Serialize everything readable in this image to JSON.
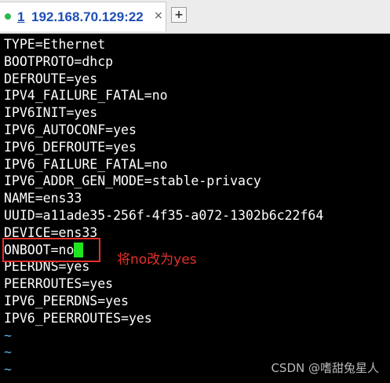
{
  "tab": {
    "index": "1",
    "title": "192.168.70.129:22",
    "close_label": "×",
    "status_color": "#2db84d"
  },
  "new_tab_label": "+",
  "terminal": {
    "lines": [
      "TYPE=Ethernet",
      "BOOTPROTO=dhcp",
      "DEFROUTE=yes",
      "IPV4_FAILURE_FATAL=no",
      "IPV6INIT=yes",
      "IPV6_AUTOCONF=yes",
      "IPV6_DEFROUTE=yes",
      "IPV6_FAILURE_FATAL=no",
      "IPV6_ADDR_GEN_MODE=stable-privacy",
      "NAME=ens33",
      "UUID=a11ade35-256f-4f35-a072-1302b6c22f64",
      "DEVICE=ens33",
      "ONBOOT=no",
      "PEERDNS=yes",
      "PEERROUTES=yes",
      "IPV6_PEERDNS=yes",
      "IPV6_PEERROUTES=yes"
    ],
    "tildes": [
      "~",
      "~",
      "~"
    ],
    "cursor_color": "#1fe51f"
  },
  "annotation": {
    "text": "将no改为yes",
    "color": "#e5302a"
  },
  "watermark": "CSDN @嗜甜兔星人"
}
